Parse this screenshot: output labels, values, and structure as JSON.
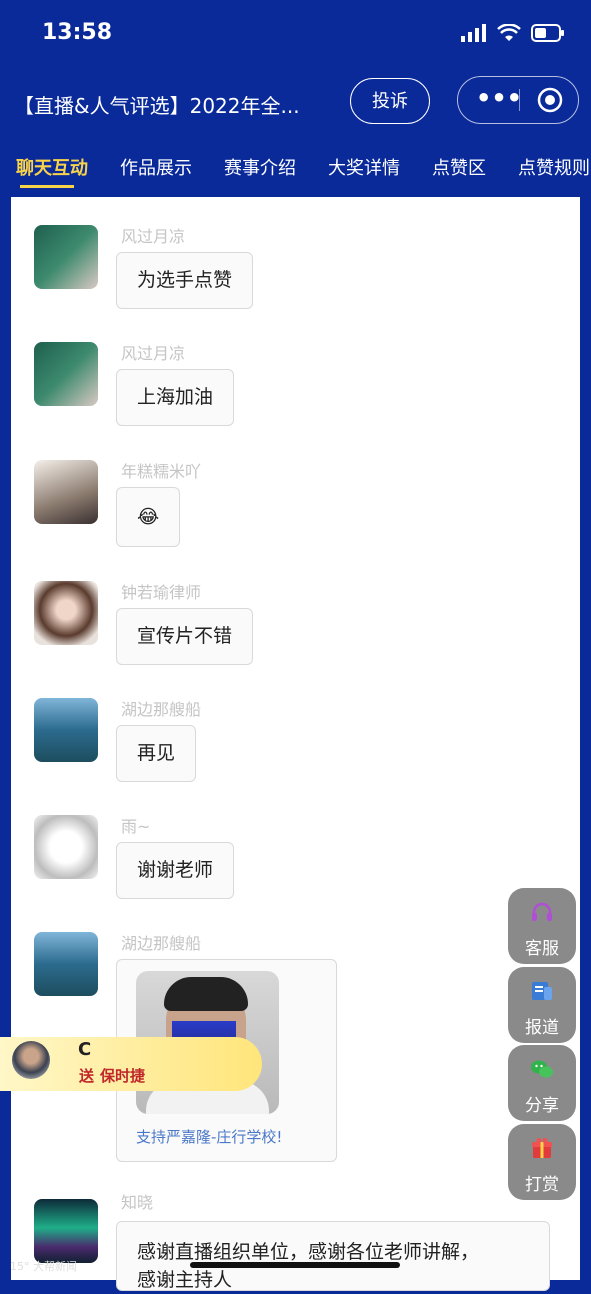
{
  "status": {
    "time": "13:58"
  },
  "header": {
    "title": "【直播&人气评选】2022年全...",
    "complain_label": "投诉",
    "more_label": "•••"
  },
  "tabs": [
    "聊天互动",
    "作品展示",
    "赛事介绍",
    "大奖详情",
    "点赞区",
    "点赞规则"
  ],
  "messages": [
    {
      "user": "风过月凉",
      "text": "为选手点赞"
    },
    {
      "user": "风过月凉",
      "text": "上海加油"
    },
    {
      "user": "年糕糯米吖",
      "text": "😂"
    },
    {
      "user": "钟若瑜律师",
      "text": "宣传片不错"
    },
    {
      "user": "湖边那艘船",
      "text": "再见"
    },
    {
      "user": "雨~",
      "text": "谢谢老师"
    },
    {
      "user": "湖边那艘船",
      "text": "",
      "card_caption": "支持严嘉隆-庄行学校!"
    },
    {
      "user": "知晓",
      "text": "感谢直播组织单位，感谢各位老师讲解，",
      "text2": "感谢主持人"
    }
  ],
  "gift": {
    "user": "C",
    "verb": "送",
    "item": "保时捷"
  },
  "float_buttons": [
    {
      "label": "客服",
      "icon": "headset-icon"
    },
    {
      "label": "报道",
      "icon": "report-icon"
    },
    {
      "label": "分享",
      "icon": "wechat-icon"
    },
    {
      "label": "打赏",
      "icon": "gift-icon"
    }
  ],
  "watermark_left": "15° 大帮新闻",
  "colors": {
    "brand": "#0a2a9a",
    "active_tab": "#f7d34a",
    "float": "#8a8a8a"
  }
}
